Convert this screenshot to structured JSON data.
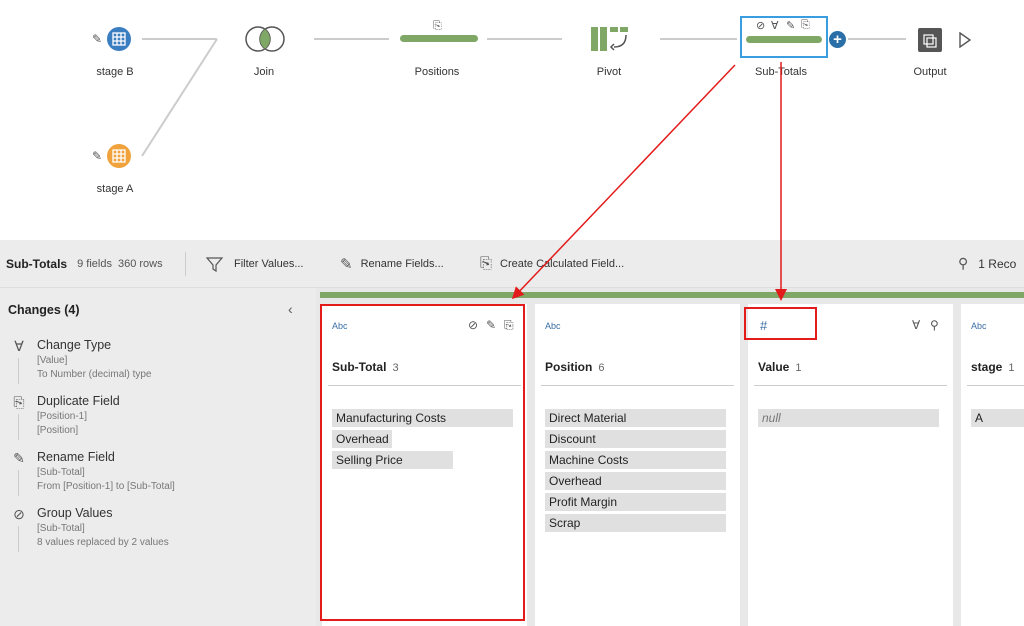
{
  "flow": {
    "nodes": {
      "stage_b": "stage B",
      "join": "Join",
      "positions": "Positions",
      "pivot": "Pivot",
      "subtotals": "Sub-Totals",
      "output": "Output",
      "stage_a": "stage A"
    }
  },
  "toolbar": {
    "step_name": "Sub-Totals",
    "fields": "9 fields",
    "rows": "360 rows",
    "filter_label": "Filter Values...",
    "rename_label": "Rename Fields...",
    "calc_label": "Create Calculated Field...",
    "recommend_label": "1 Reco"
  },
  "changes": {
    "title": "Changes (4)",
    "items": [
      {
        "title": "Change Type",
        "line1": "[Value]",
        "line2": "To Number (decimal) type"
      },
      {
        "title": "Duplicate Field",
        "line1": "[Position-1]",
        "line2": "[Position]"
      },
      {
        "title": "Rename Field",
        "line1": "[Sub-Total]",
        "line2": "From [Position-1] to [Sub-Total]"
      },
      {
        "title": "Group Values",
        "line1": "[Sub-Total]",
        "line2": "8 values replaced by 2 values"
      }
    ]
  },
  "columns": [
    {
      "type": "Abc",
      "name": "Sub-Total",
      "count": "3",
      "values": [
        "Manufacturing Costs",
        "Overhead",
        "Selling Price"
      ]
    },
    {
      "type": "Abc",
      "name": "Position",
      "count": "6",
      "values": [
        "Direct Material",
        "Discount",
        "Machine Costs",
        "Overhead",
        "Profit Margin",
        "Scrap"
      ]
    },
    {
      "type": "#",
      "name": "Value",
      "count": "1",
      "values": [
        "null"
      ]
    },
    {
      "type": "Abc",
      "name": "stage",
      "count": "1",
      "values": [
        "A"
      ]
    }
  ],
  "colors": {
    "green": "#7fa765",
    "highlight": "#e31b1b",
    "blue": "#3a7dc0",
    "orange": "#f0a23c"
  }
}
